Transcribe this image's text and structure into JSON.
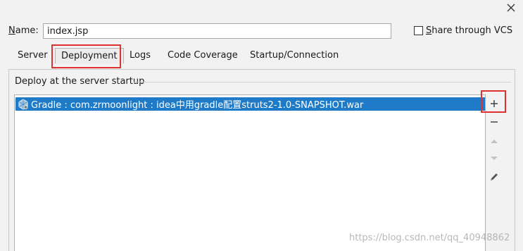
{
  "dialog": {
    "name_label_prefix": "",
    "name_label_accel": "N",
    "name_label_rest": "ame:",
    "name_value": "index.jsp",
    "share_label_accel": "S",
    "share_label_rest": "hare through VCS",
    "share_checked": false
  },
  "tabs": [
    {
      "label": "Server"
    },
    {
      "label": "Deployment",
      "active": true
    },
    {
      "label": "Logs"
    },
    {
      "label": "Code Coverage"
    },
    {
      "label": "Startup/Connection"
    }
  ],
  "deploy": {
    "section_title": "Deploy at the server startup",
    "items": [
      {
        "label": "Gradle : com.zrmoonlight : idea中用gradle配置struts2-1.0-SNAPSHOT.war",
        "selected": true,
        "icon": "gradle-artifact-icon"
      }
    ]
  },
  "side_toolbar": {
    "add_icon": "plus-icon",
    "remove_icon": "minus-icon",
    "up_icon": "move-up-icon",
    "down_icon": "move-down-icon",
    "edit_icon": "pencil-icon"
  },
  "watermark": "https://blog.csdn.net/qq_40948862",
  "colors": {
    "selection": "#1f7bc7",
    "highlight": "#e03131",
    "background": "#f2f2f2"
  }
}
